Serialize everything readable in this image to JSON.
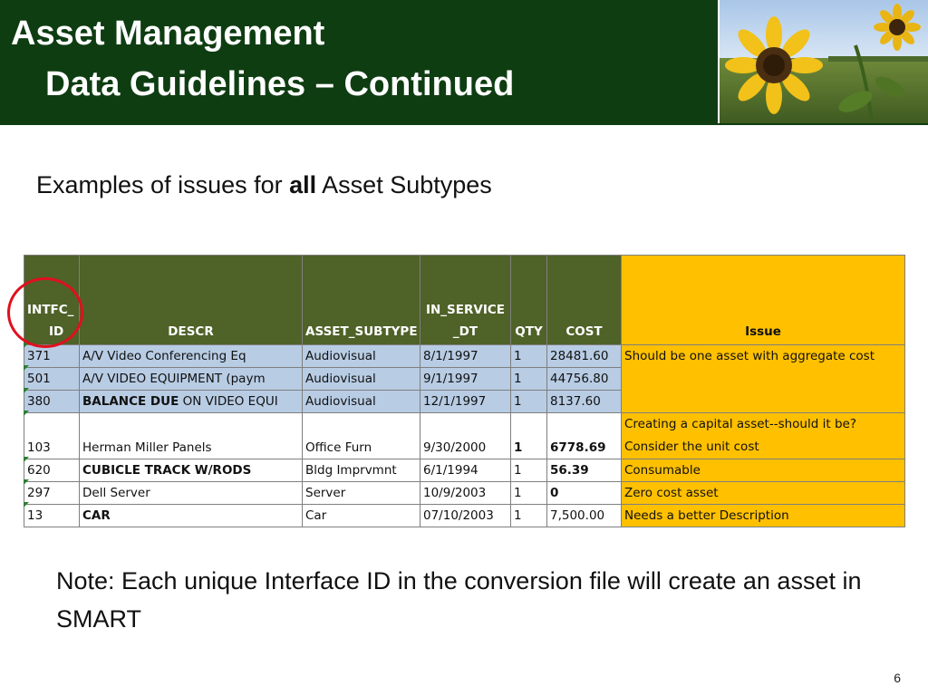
{
  "header": {
    "title_line1": "Asset Management",
    "title_line2": "Data Guidelines – Continued",
    "bg_color": "#0f3d12"
  },
  "subtitle": {
    "prefix": "Examples of issues for ",
    "emphasis": "all",
    "suffix": " Asset Subtypes"
  },
  "table": {
    "columns": {
      "id_line1": "INTFC_",
      "id_line2": "ID",
      "descr": "DESCR",
      "subtype": "ASSET_SUBTYPE",
      "in_service_line1": "IN_SERVICE",
      "in_service_line2": "_DT",
      "qty": "QTY",
      "cost": "COST",
      "issue": "Issue"
    },
    "rows": [
      {
        "id": "371",
        "descr": "A/V Video Conferencing Eq",
        "subtype": "Audiovisual",
        "date": "8/1/1997",
        "qty": "1",
        "cost": "28481.60"
      },
      {
        "id": "501",
        "descr": "A/V VIDEO EQUIPMENT (paym",
        "subtype": "Audiovisual",
        "date": "9/1/1997",
        "qty": "1",
        "cost": "44756.80"
      },
      {
        "id": "380",
        "descr_bold": "BALANCE DUE",
        "descr_rest": " ON VIDEO EQUI",
        "subtype": "Audiovisual",
        "date": "12/1/1997",
        "qty": "1",
        "cost": "8137.60"
      },
      {
        "id": "103",
        "descr": "Herman Miller Panels",
        "subtype": "Office Furn",
        "date": "9/30/2000",
        "qty": "1",
        "cost": "6778.69"
      },
      {
        "id": "620",
        "descr": "CUBICLE TRACK W/RODS",
        "subtype": "Bldg Imprvmnt",
        "date": "6/1/1994",
        "qty": "1",
        "cost": "56.39"
      },
      {
        "id": "297",
        "descr": "Dell Server",
        "subtype": "Server",
        "date": "10/9/2003",
        "qty": "1",
        "cost": "0"
      },
      {
        "id": "13",
        "descr": "CAR",
        "subtype": "Car",
        "date": "07/10/2003",
        "qty": "1",
        "cost": "7,500.00"
      }
    ],
    "issues": {
      "group1": "Should be one asset with aggregate cost",
      "row103_line1": "Creating a capital asset--should it be?",
      "row103_line2": "Consider the unit cost",
      "row620": "Consumable",
      "row297": "Zero cost asset",
      "row13": "Needs a better Description"
    },
    "colors": {
      "header_green": "#4f6228",
      "issue_yellow": "#ffc000",
      "row_blue": "#b8cce4",
      "highlight_circle": "#e0101e"
    }
  },
  "note": {
    "text": "Note: Each unique Interface ID in the conversion file will create an asset in SMART"
  },
  "footer": {
    "page_number": "6"
  }
}
